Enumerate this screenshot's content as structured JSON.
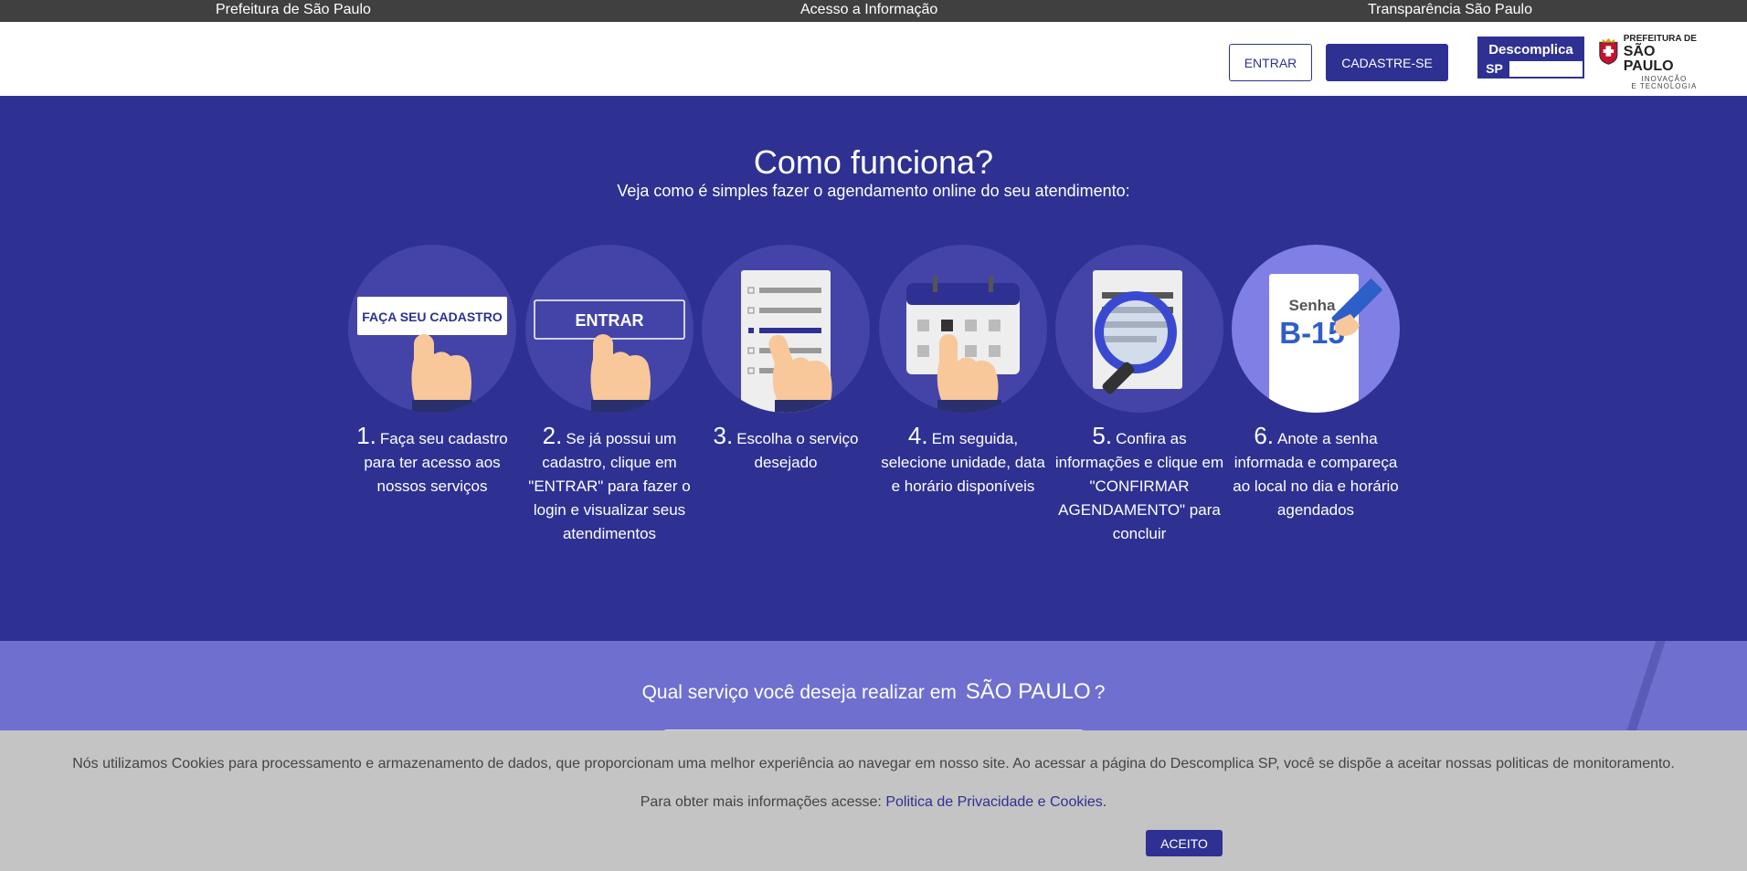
{
  "topbar": {
    "links": [
      "Prefeitura de São Paulo",
      "Acesso a Informação",
      "Transparência São Paulo"
    ]
  },
  "header": {
    "login_label": "ENTRAR",
    "signup_label": "CADASTRE-SE",
    "logo_descomplica": {
      "line1": "Descomplica",
      "line2": "SP"
    },
    "logo_prefeitura": {
      "line1": "PREFEITURA DE",
      "line2": "SÃO PAULO",
      "line3": "INOVAÇÃO",
      "line4": "E TECNOLOGIA"
    }
  },
  "how_it_works": {
    "title": "Como funciona?",
    "subtitle": "Veja como é simples fazer o agendamento online do seu atendimento:",
    "steps": [
      {
        "number": "1.",
        "text": "Faça seu cadastro para ter acesso aos nossos serviços",
        "illustration_label": "FAÇA SEU CADASTRO"
      },
      {
        "number": "2.",
        "text": "Se já possui um cadastro, clique em \"ENTRAR\" para fazer o login e visualizar seus atendimentos",
        "illustration_label": "ENTRAR"
      },
      {
        "number": "3.",
        "text": "Escolha o serviço desejado"
      },
      {
        "number": "4.",
        "text": "Em seguida, selecione unidade, data e horário disponíveis"
      },
      {
        "number": "5.",
        "text": "Confira as informações e clique em \"CONFIRMAR AGENDAMENTO\" para concluir"
      },
      {
        "number": "6.",
        "text": "Anote a senha informada e compareça ao local no dia e horário agendados",
        "illustration_label": "Senha",
        "illustration_code": "B-15"
      }
    ]
  },
  "search": {
    "question_prefix": "Qual serviço você deseja realizar em",
    "city": "SÃO PAULO",
    "question_suffix": "?"
  },
  "cookie": {
    "message": "Nós utilizamos Cookies para processamento e armazenamento de dados, que proporcionam uma melhor experiência ao navegar em nosso site. Ao acessar a página do Descomplica SP, você se dispõe a aceitar nossas politicas de monitoramento.",
    "more_prefix": "Para obter mais informações acesse:",
    "policy_link": "Politica de Privacidade e Cookies.",
    "accept_label": "ACEITO"
  },
  "colors": {
    "primary": "#2e3192",
    "topbar": "#404040",
    "cookie_bg": "#c4c4c4"
  }
}
